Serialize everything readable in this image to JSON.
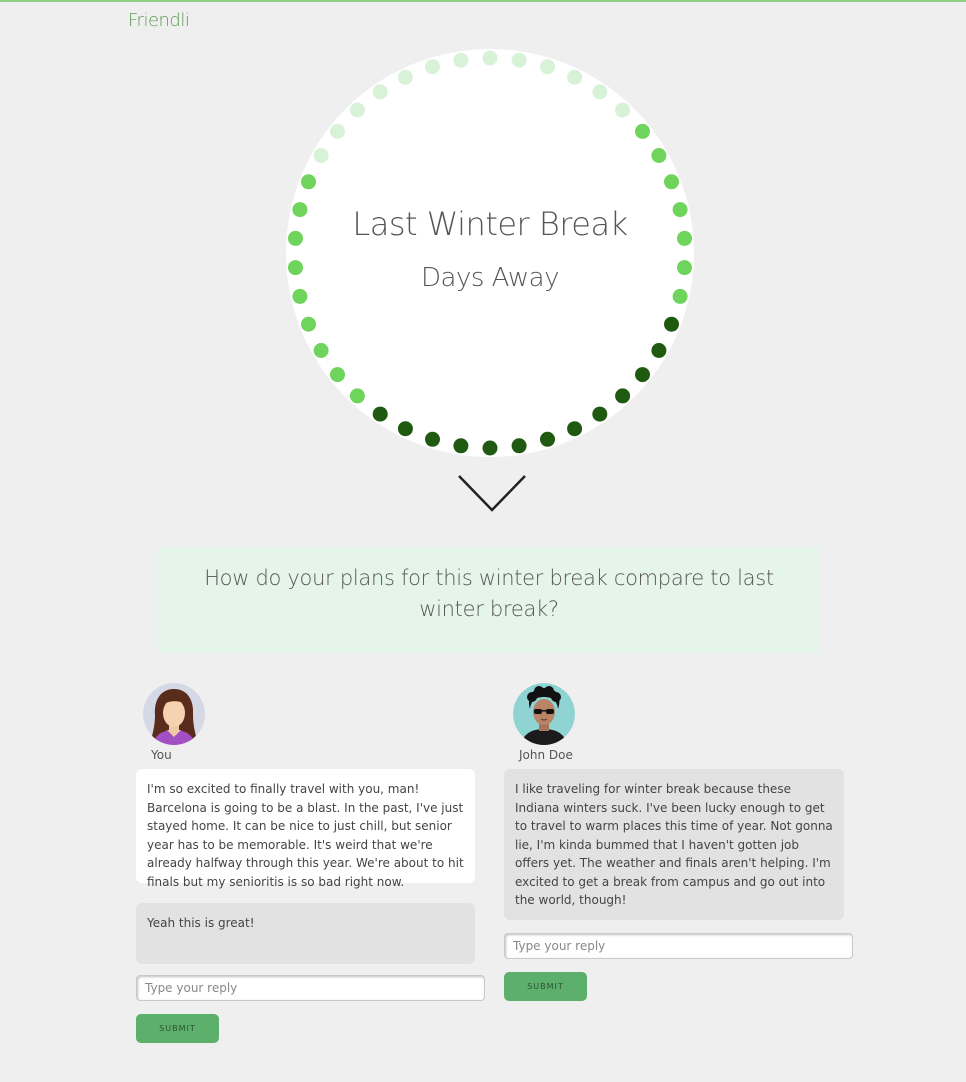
{
  "app": {
    "brand": "Friendli"
  },
  "countdown": {
    "title": "Last Winter Break",
    "subtitle": "Days Away",
    "colors": {
      "pale": "#d8f2d8",
      "bright": "#6fd45b",
      "dark": "#1f5a10"
    }
  },
  "prompt": {
    "question": "How do your plans for this winter break compare to last winter break?"
  },
  "you": {
    "name": "You",
    "message": "I'm so excited to finally travel with you, man! Barcelona is going to be a blast. In the past, I've just stayed home. It can be nice to just chill, but senior year has to be memorable. It's weird that we're already halfway through this year. We're about to hit finals but my senioritis is so bad right now.",
    "reply": "Yeah this is great!",
    "input_placeholder": "Type your reply",
    "submit_label": "SUBMIT"
  },
  "john": {
    "name": "John Doe",
    "message": "I like traveling for winter break because these Indiana winters suck. I've been lucky enough to get to travel to warm places this time of year. Not gonna lie, I'm kinda bummed that I haven't gotten job offers yet. The weather and finals aren't helping. I'm excited to get a break from campus and go out into the world, though!",
    "input_placeholder": "Type your reply",
    "submit_label": "SUBMIT"
  }
}
